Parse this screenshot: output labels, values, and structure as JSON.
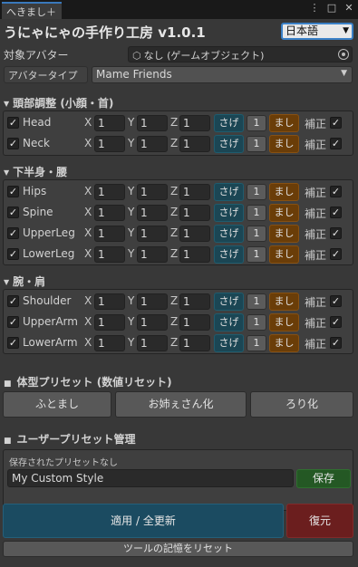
{
  "window": {
    "tab_label": "へきまし＋",
    "menu_icon": "kebab-icon",
    "maximize_icon": "maximize-icon",
    "close_icon": "close-icon"
  },
  "header": {
    "title": "うにゃにゃの手作り工房 v1.0.1",
    "language": "日本語"
  },
  "target": {
    "label": "対象アバター",
    "value": "なし (ゲームオブジェクト)"
  },
  "avatar_type": {
    "label": "アバタータイプ",
    "value": "Mame Friends"
  },
  "common": {
    "x": "X",
    "y": "Y",
    "z": "Z",
    "sage": "さげ",
    "one": "1",
    "mashi": "まし",
    "hosei": "補正",
    "check": "✓"
  },
  "sections": {
    "head": {
      "title": "頭部調整 (小顔・首)",
      "rows": [
        {
          "name": "Head",
          "x": "1",
          "y": "1",
          "z": "1"
        },
        {
          "name": "Neck",
          "x": "1",
          "y": "1",
          "z": "1"
        }
      ]
    },
    "lower": {
      "title": "下半身・腰",
      "rows": [
        {
          "name": "Hips",
          "x": "1",
          "y": "1",
          "z": "1"
        },
        {
          "name": "Spine",
          "x": "1",
          "y": "1",
          "z": "1"
        },
        {
          "name": "UpperLeg",
          "x": "1",
          "y": "1",
          "z": "1"
        },
        {
          "name": "LowerLeg",
          "x": "1",
          "y": "1",
          "z": "1"
        }
      ]
    },
    "arms": {
      "title": "腕・肩",
      "rows": [
        {
          "name": "Shoulder",
          "x": "1",
          "y": "1",
          "z": "1"
        },
        {
          "name": "UpperArm",
          "x": "1",
          "y": "1",
          "z": "1"
        },
        {
          "name": "LowerArm",
          "x": "1",
          "y": "1",
          "z": "1"
        }
      ]
    }
  },
  "body_presets": {
    "title": "体型プリセット (数値リセット)",
    "buttons": [
      "ふとまし",
      "お姉ぇさん化",
      "ろり化"
    ]
  },
  "user_presets": {
    "title": "ユーザープリセット管理",
    "saved_text": "保存されたプリセットなし",
    "input_value": "My Custom Style",
    "save_label": "保存"
  },
  "footer": {
    "apply_label": "適用 / 全更新",
    "restore_label": "復元",
    "reset_label": "ツールの記憶をリセット"
  }
}
